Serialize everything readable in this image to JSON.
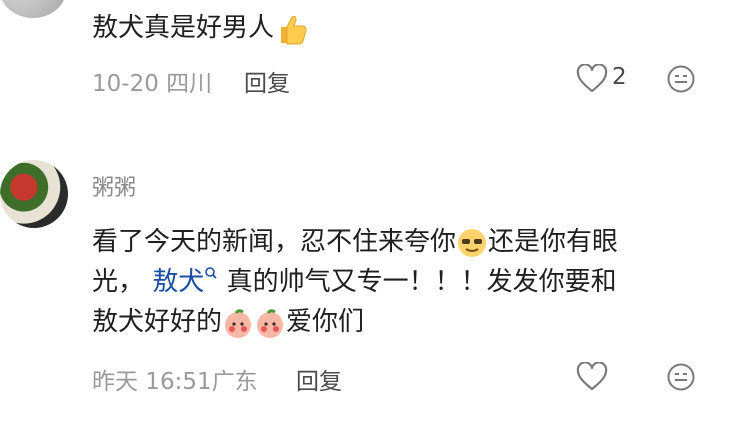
{
  "comments": [
    {
      "text": "敖犬真是好男人",
      "date": "10-20",
      "location": "四川",
      "reply_label": "回复",
      "like_count": "2"
    },
    {
      "username": "粥粥",
      "text_part1": "看了今天的新闻，忍不住来夸你",
      "text_part2": "还是你有眼",
      "text_part3": "光，",
      "mention": "敖犬",
      "text_part4": "真的帅气又专一！！！发发你要和",
      "text_part5": "敖犬好好的",
      "text_part6": "爱你们",
      "date": "昨天 16:51",
      "location": "广东",
      "reply_label": "回复"
    }
  ],
  "icons": {
    "thumbs_up": "thumbs-up-emoji",
    "like": "heart-outline-icon",
    "emoji_reaction": "smiley-face-icon",
    "mention_search": "search-icon"
  },
  "colors": {
    "mention": "#1b4fa3",
    "meta": "#9a9a9a",
    "text": "#1f1f1f"
  }
}
